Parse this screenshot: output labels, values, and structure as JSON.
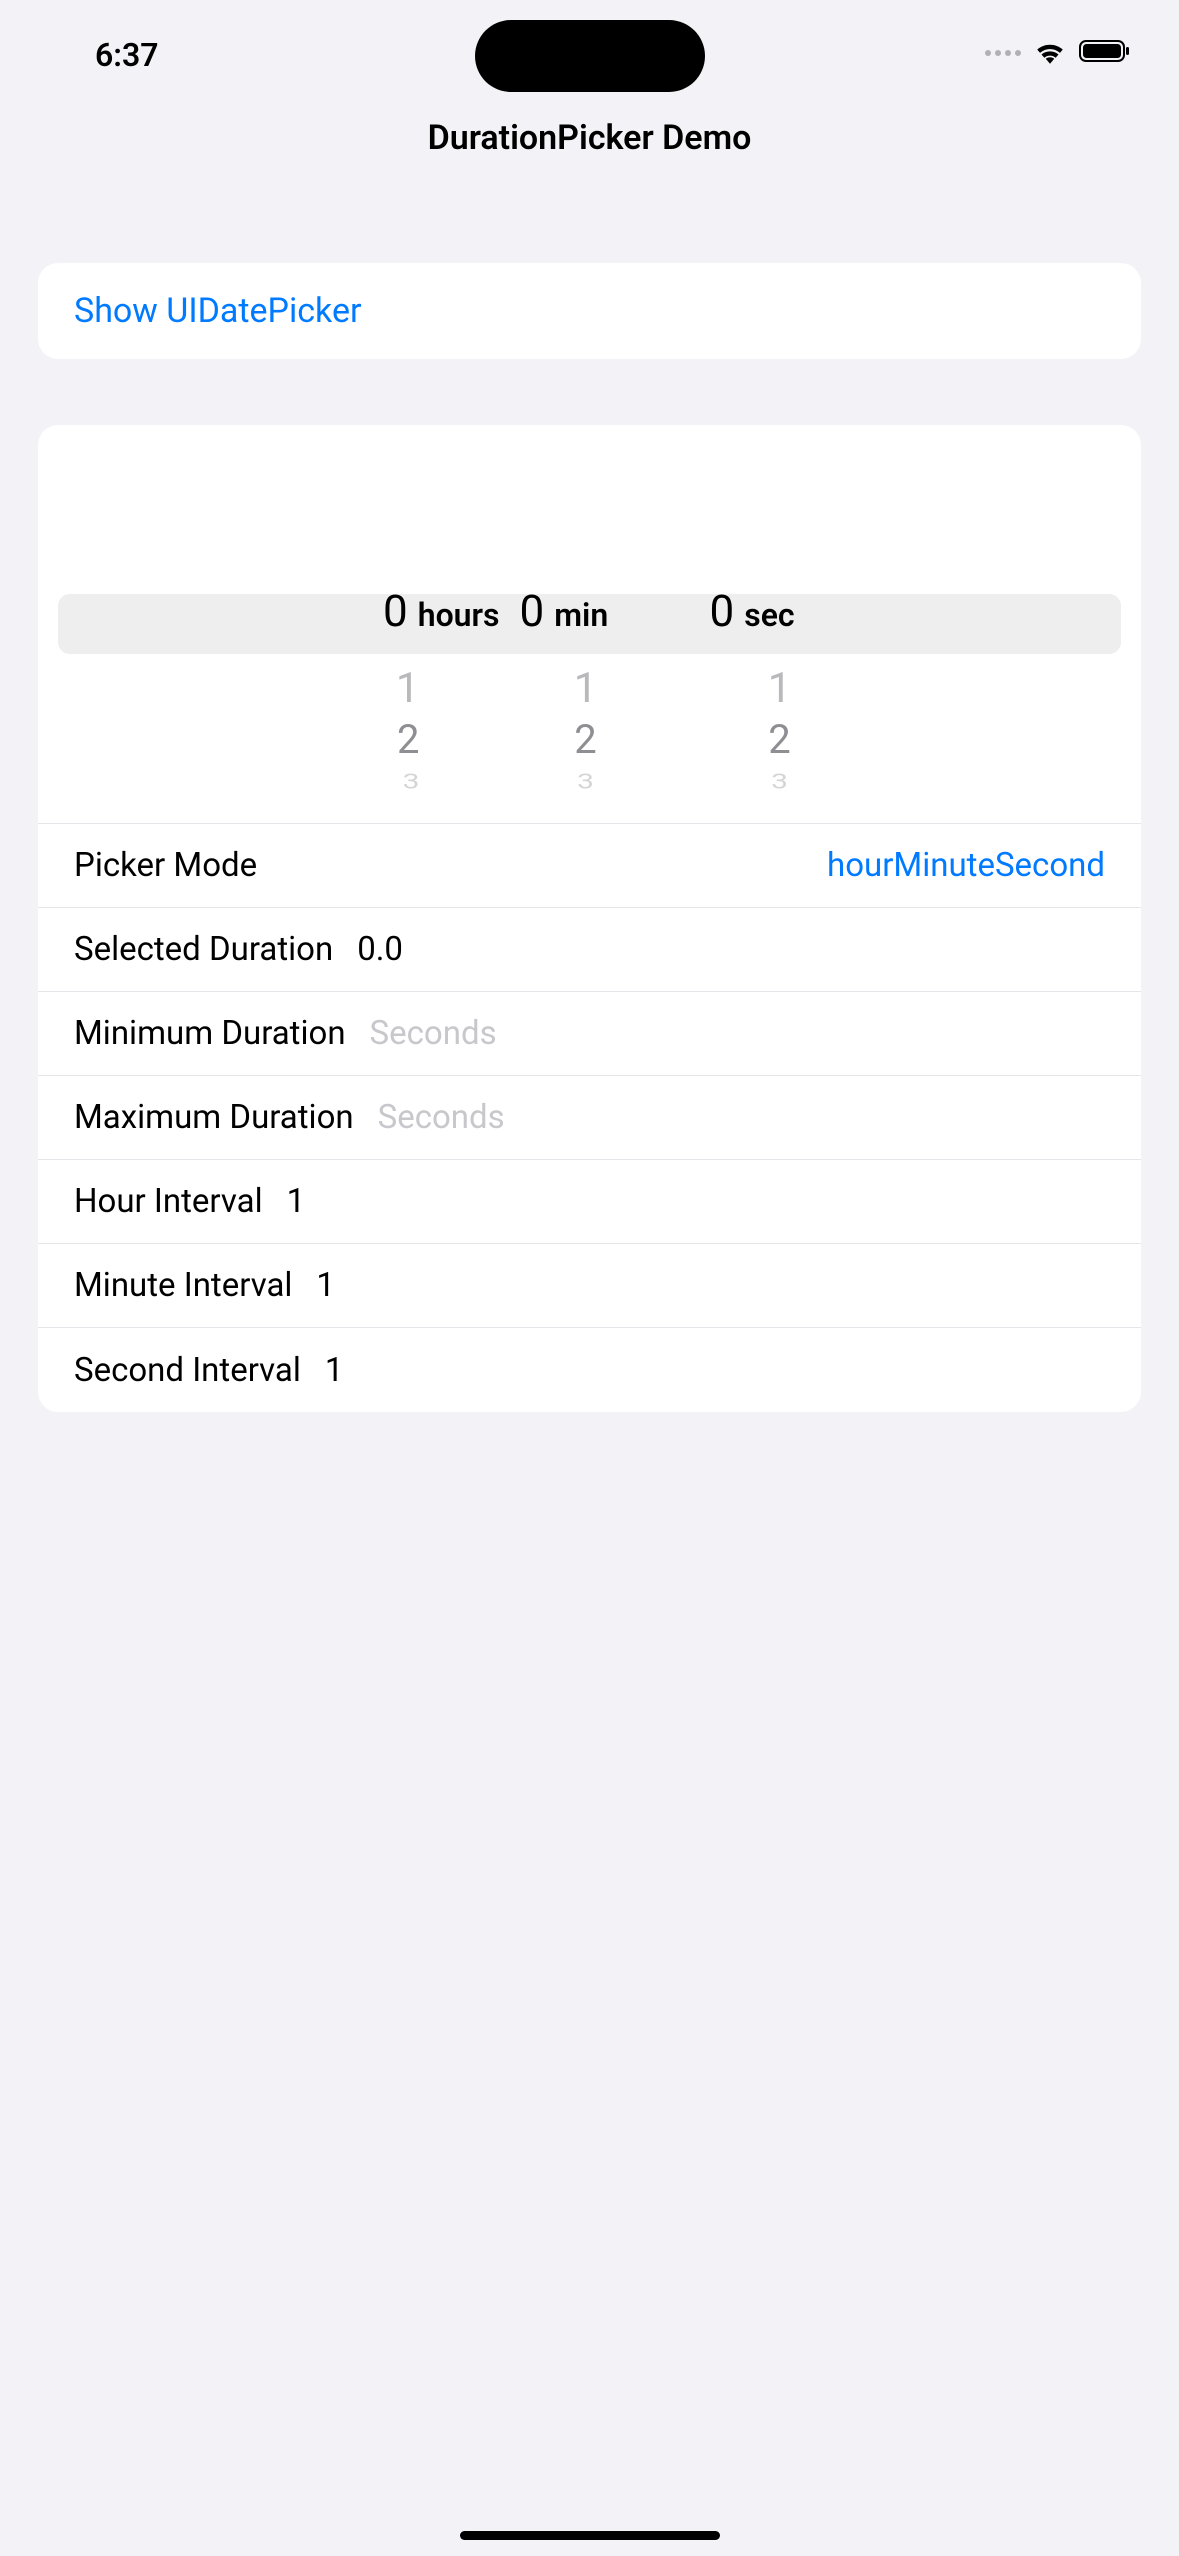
{
  "status_bar": {
    "time": "6:37"
  },
  "page_title": "DurationPicker Demo",
  "show_button_label": "Show UIDatePicker",
  "picker": {
    "hours": {
      "selected": "0",
      "unit": "hours",
      "next": [
        "1",
        "2",
        "3"
      ]
    },
    "minutes": {
      "selected": "0",
      "unit": "min",
      "next": [
        "1",
        "2",
        "3"
      ]
    },
    "seconds": {
      "selected": "0",
      "unit": "sec",
      "next": [
        "1",
        "2",
        "3"
      ]
    }
  },
  "settings": {
    "picker_mode": {
      "label": "Picker Mode",
      "value": "hourMinuteSecond"
    },
    "selected_duration": {
      "label": "Selected Duration",
      "value": "0.0"
    },
    "minimum_duration": {
      "label": "Minimum Duration",
      "placeholder": "Seconds",
      "value": ""
    },
    "maximum_duration": {
      "label": "Maximum Duration",
      "placeholder": "Seconds",
      "value": ""
    },
    "hour_interval": {
      "label": "Hour Interval",
      "value": "1"
    },
    "minute_interval": {
      "label": "Minute Interval",
      "value": "1"
    },
    "second_interval": {
      "label": "Second Interval",
      "value": "1"
    }
  }
}
